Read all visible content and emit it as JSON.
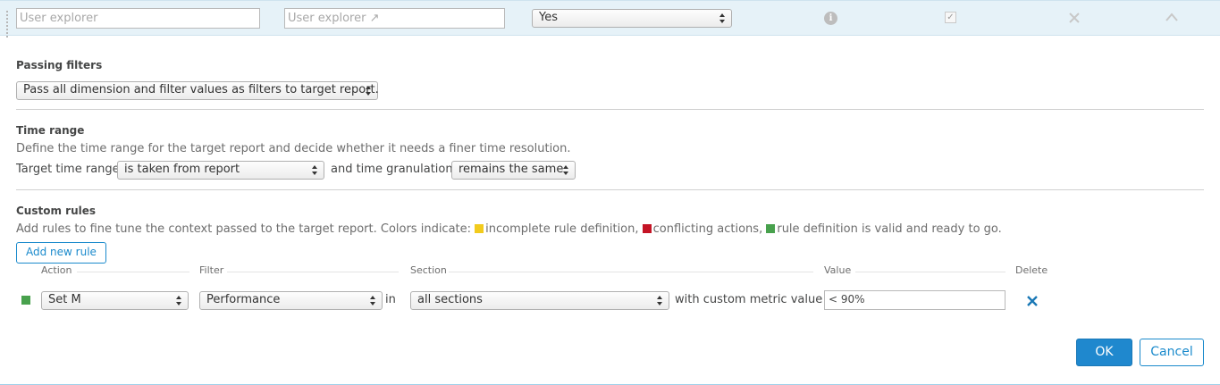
{
  "top_row": {
    "name_placeholder": "User explorer",
    "link_placeholder": "User explorer ↗",
    "enabled_value": "Yes",
    "icons": [
      "info-icon",
      "checkbox-icon",
      "close-icon",
      "chevron-up-icon"
    ]
  },
  "passing_filters": {
    "title": "Passing filters",
    "select_value": "Pass all dimension and filter values as filters to target report."
  },
  "time_range": {
    "title": "Time range",
    "description": "Define the time range for the target report and decide whether it needs a finer time resolution.",
    "target_label": "Target time range",
    "target_value": "is taken from report",
    "granulation_label": "and time granulation",
    "granulation_value": "remains the same"
  },
  "custom_rules": {
    "title": "Custom rules",
    "description_prefix": "Add rules to fine tune the context passed to the target report. Colors indicate: ",
    "legend": [
      {
        "color": "#f2cb1d",
        "label": "incomplete rule definition,"
      },
      {
        "color": "#c41425",
        "label": "conflicting actions,"
      },
      {
        "color": "#48a14d",
        "label": "rule definition is valid and ready to go."
      }
    ],
    "add_button": "Add new rule",
    "columns": {
      "action": "Action",
      "filter": "Filter",
      "section": "Section",
      "value": "Value",
      "delete": "Delete"
    },
    "rule": {
      "status_color": "#48a14d",
      "action": "Set M",
      "filter": "Performance",
      "in_text": "in",
      "section": "all sections",
      "metric_text": "with custom metric value",
      "value": "< 90%"
    }
  },
  "footer": {
    "ok": "OK",
    "cancel": "Cancel"
  }
}
